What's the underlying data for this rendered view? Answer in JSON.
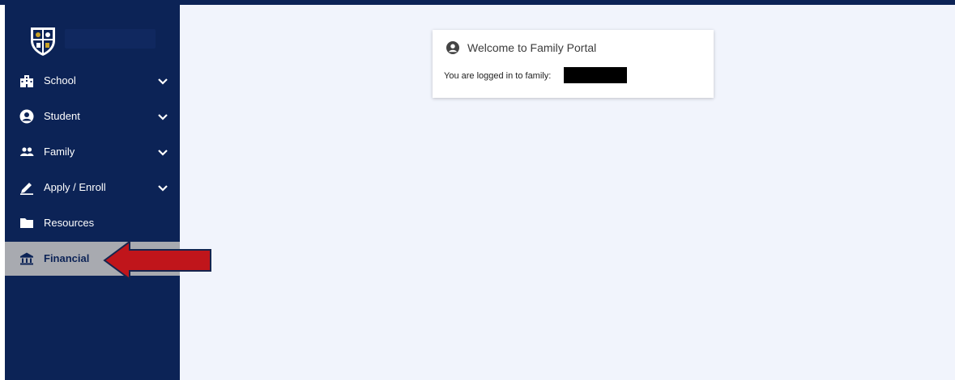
{
  "sidebar": {
    "items": [
      {
        "label": "School",
        "icon": "school-building-icon",
        "expandable": true
      },
      {
        "label": "Student",
        "icon": "user-circle-icon",
        "expandable": true
      },
      {
        "label": "Family",
        "icon": "people-icon",
        "expandable": true
      },
      {
        "label": "Apply / Enroll",
        "icon": "pencil-icon",
        "expandable": true
      },
      {
        "label": "Resources",
        "icon": "folder-icon",
        "expandable": false
      },
      {
        "label": "Financial",
        "icon": "bank-icon",
        "expandable": false,
        "active": true
      }
    ]
  },
  "card": {
    "title": "Welcome to Family Portal",
    "text": "You are logged in to family:"
  },
  "colors": {
    "sidebar": "#0c2356",
    "main_bg": "#f1f4fc",
    "active_item": "#a8aab0",
    "arrow": "#c0151b"
  }
}
